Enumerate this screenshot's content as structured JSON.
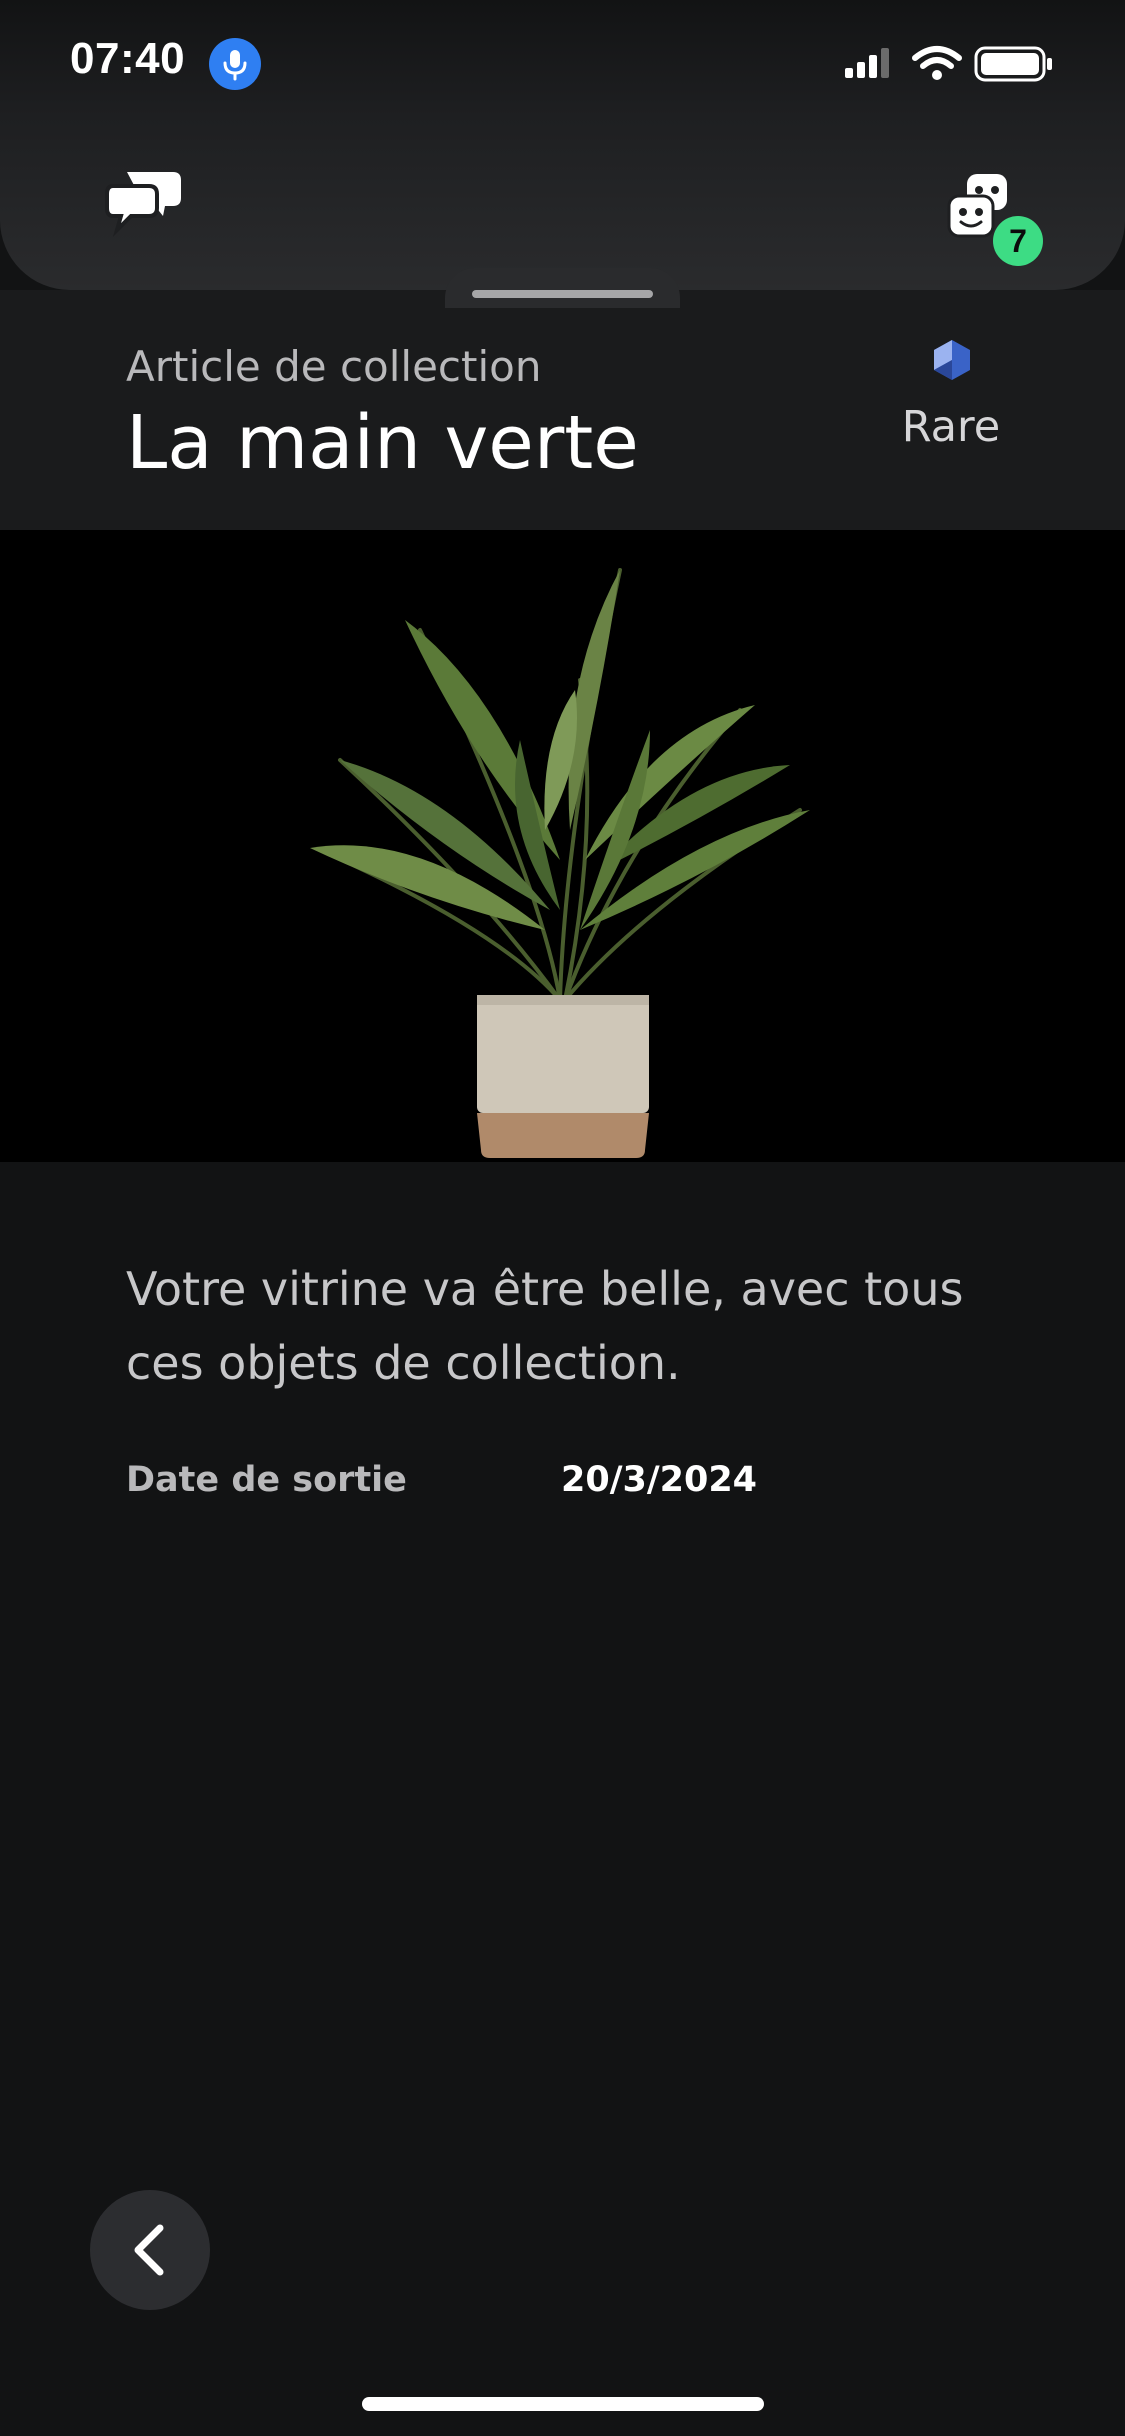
{
  "status_bar": {
    "time": "07:40",
    "icons": [
      "microphone-icon",
      "cellular-signal-icon",
      "wifi-icon",
      "battery-icon"
    ]
  },
  "header": {
    "chat_icon": "chat-bubbles-icon",
    "party_icon": "party-masks-icon",
    "party_badge": "7",
    "badge_color": "#3ddc84"
  },
  "item": {
    "category": "Article de collection",
    "title": "La main verte",
    "rarity": "Rare",
    "rarity_color": "#3a63c7",
    "image": "potted-plant-image",
    "description": "Votre vitrine va être belle, avec tous ces objets de collection.",
    "release_label": "Date de sortie",
    "release_date": "20/3/2024"
  },
  "navigation": {
    "back_icon": "chevron-left-icon"
  }
}
